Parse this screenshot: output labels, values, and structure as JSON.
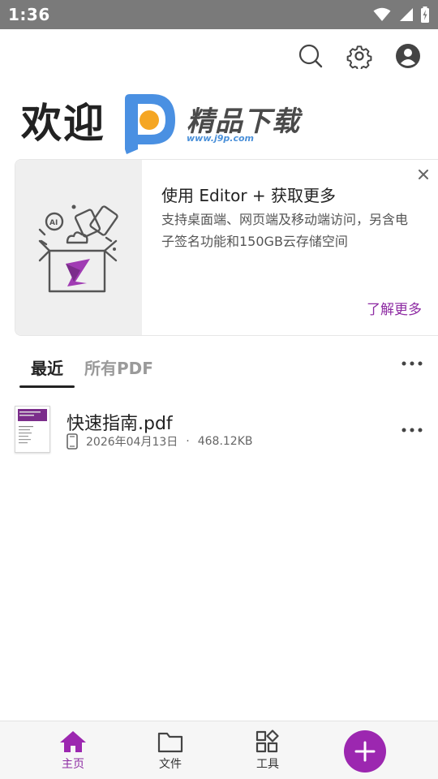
{
  "status_bar": {
    "time": "1:36"
  },
  "header": {
    "welcome": "欢迎",
    "watermark": {
      "brand": "精品下载",
      "url": "www.j9p.com"
    }
  },
  "promo": {
    "title": "使用 Editor + 获取更多",
    "description": "支持桌面端、网页端及移动端访问，另含电子签名功能和150GB云存储空间",
    "link": "了解更多",
    "art_label": "AI"
  },
  "tabs": [
    {
      "label": "最近",
      "active": true
    },
    {
      "label": "所有PDF",
      "active": false
    }
  ],
  "files": [
    {
      "name": "快速指南.pdf",
      "date": "2026年04月13日",
      "separator": "·",
      "size": "468.12KB"
    }
  ],
  "bottom_nav": {
    "items": [
      {
        "label": "主页",
        "icon": "home-icon",
        "active": true
      },
      {
        "label": "文件",
        "icon": "folder-icon",
        "active": false
      },
      {
        "label": "工具",
        "icon": "tools-icon",
        "active": false
      }
    ],
    "fab_icon": "plus-icon"
  },
  "colors": {
    "accent": "#9c27b0",
    "accent_text": "#8e2ca3",
    "status_bar": "#7a7a7a"
  }
}
